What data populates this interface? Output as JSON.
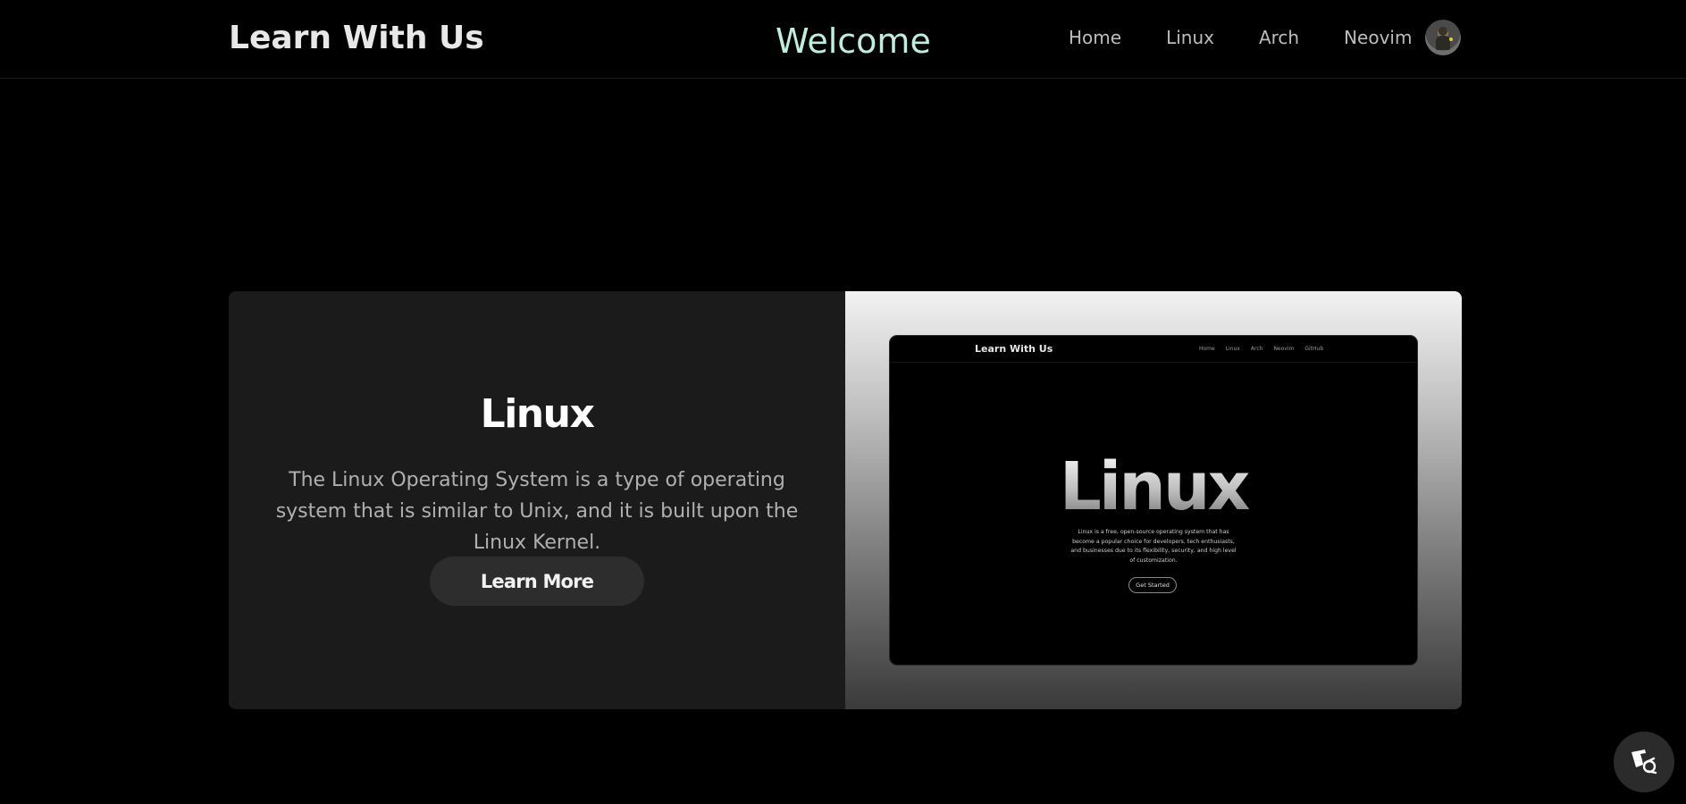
{
  "header": {
    "brand": "Learn With Us",
    "welcome": "Welcome",
    "nav": [
      "Home",
      "Linux",
      "Arch",
      "Neovim"
    ]
  },
  "card": {
    "title": "Linux",
    "description": "The Linux Operating System is a type of operating system that is similar to Unix, and it is built upon the Linux Kernel.",
    "button_label": "Learn More",
    "preview": {
      "brand": "Learn With Us",
      "nav": [
        "Home",
        "Linux",
        "Arch",
        "Neovim",
        "GitHub"
      ],
      "title": "Linux",
      "description": "Linux is a free, open-source operating system that has become a popular choice for developers, tech enthusiasts, and businesses due to its flexibility, security, and high level of customization.",
      "button_label": "Get Started"
    }
  },
  "icons": {
    "avatar": "user-avatar",
    "floating": "accessibility-wheelchair-icon"
  },
  "colors": {
    "background": "#000000",
    "card_left": "#1b1b1b",
    "welcome_text": "#bfeee0",
    "nav_text": "#bdbdbd"
  }
}
